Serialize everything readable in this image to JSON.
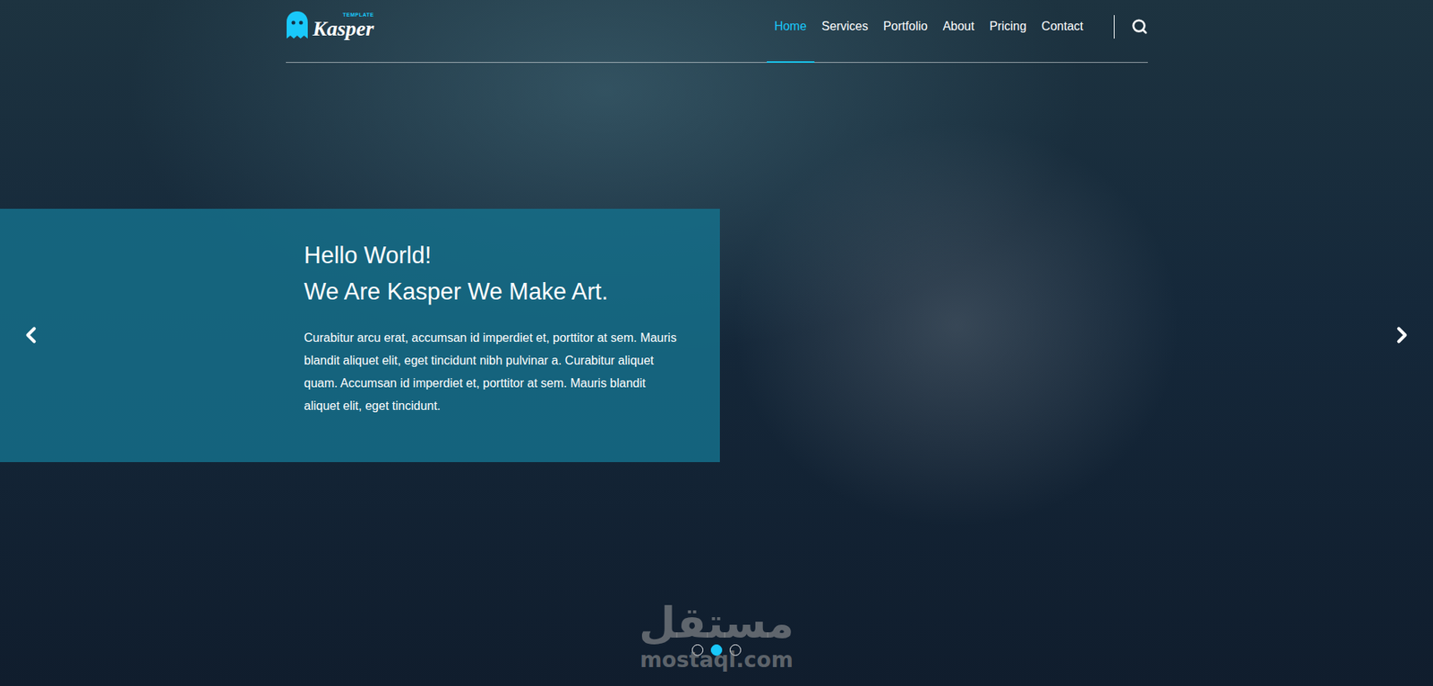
{
  "logo": {
    "name": "Kasper",
    "tag": "TEMPLATE"
  },
  "nav": [
    {
      "label": "Home",
      "selected": true
    },
    {
      "label": "Services",
      "selected": false
    },
    {
      "label": "Portfolio",
      "selected": false
    },
    {
      "label": "About",
      "selected": false
    },
    {
      "label": "Pricing",
      "selected": false
    },
    {
      "label": "Contact",
      "selected": false
    }
  ],
  "slide": {
    "heading": [
      "Hello World!",
      "We Are Kasper We Make Art."
    ],
    "text": "Curabitur arcu erat, accumsan id imperdiet et, porttitor at sem. Mauris blandit aliquet elit, eget tincidunt nibh pulvinar a. Curabitur aliquet quam. Accumsan id imperdiet et, porttitor at sem. Mauris blandit aliquet elit, eget tincidunt."
  },
  "bullets": [
    {
      "selected": false
    },
    {
      "selected": true
    },
    {
      "selected": false
    }
  ],
  "watermark": {
    "arabic": "مستقل",
    "latin": "mostaql.com"
  }
}
